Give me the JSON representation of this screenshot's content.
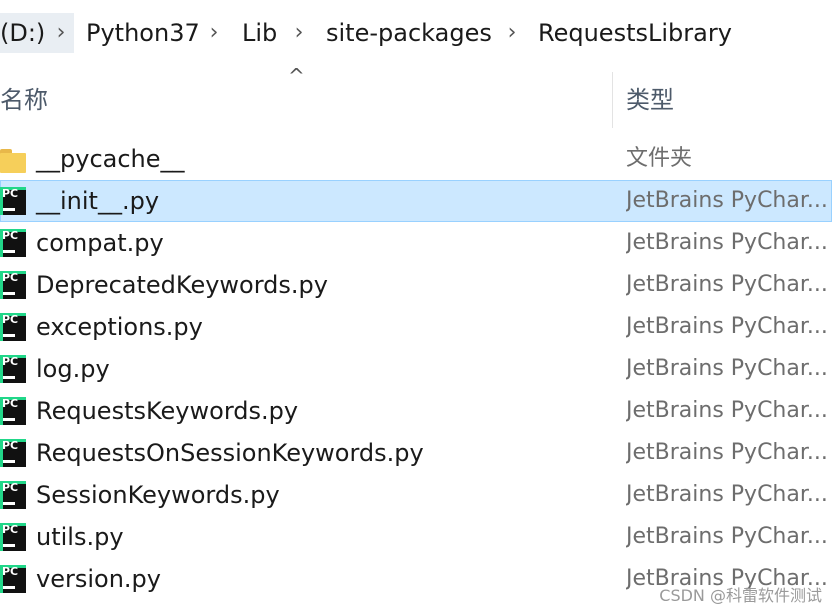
{
  "breadcrumb": {
    "items": [
      "(D:)",
      "Python37",
      "Lib",
      "site-packages",
      "RequestsLibrary"
    ],
    "separator": "›"
  },
  "columns": {
    "sort_indicator": "^",
    "name": "名称",
    "type": "类型"
  },
  "files": [
    {
      "name": "__pycache__",
      "type": "文件夹",
      "icon": "folder-icon",
      "selected": false
    },
    {
      "name": "__init__.py",
      "type": "JetBrains PyChar...",
      "icon": "pycharm-file-icon",
      "selected": true
    },
    {
      "name": "compat.py",
      "type": "JetBrains PyChar...",
      "icon": "pycharm-file-icon",
      "selected": false
    },
    {
      "name": "DeprecatedKeywords.py",
      "type": "JetBrains PyChar...",
      "icon": "pycharm-file-icon",
      "selected": false
    },
    {
      "name": "exceptions.py",
      "type": "JetBrains PyChar...",
      "icon": "pycharm-file-icon",
      "selected": false
    },
    {
      "name": "log.py",
      "type": "JetBrains PyChar...",
      "icon": "pycharm-file-icon",
      "selected": false
    },
    {
      "name": "RequestsKeywords.py",
      "type": "JetBrains PyChar...",
      "icon": "pycharm-file-icon",
      "selected": false
    },
    {
      "name": "RequestsOnSessionKeywords.py",
      "type": "JetBrains PyChar...",
      "icon": "pycharm-file-icon",
      "selected": false
    },
    {
      "name": "SessionKeywords.py",
      "type": "JetBrains PyChar...",
      "icon": "pycharm-file-icon",
      "selected": false
    },
    {
      "name": "utils.py",
      "type": "JetBrains PyChar...",
      "icon": "pycharm-file-icon",
      "selected": false
    },
    {
      "name": "version.py",
      "type": "JetBrains PyChar...",
      "icon": "pycharm-file-icon",
      "selected": false
    }
  ],
  "watermark": "CSDN @科雷软件测试",
  "colors": {
    "selection_bg": "#cce8ff",
    "selection_border": "#99d1ff",
    "folder": "#f6cf5a",
    "pycharm_green": "#21d789"
  },
  "pycharm_icon_text": "PC"
}
